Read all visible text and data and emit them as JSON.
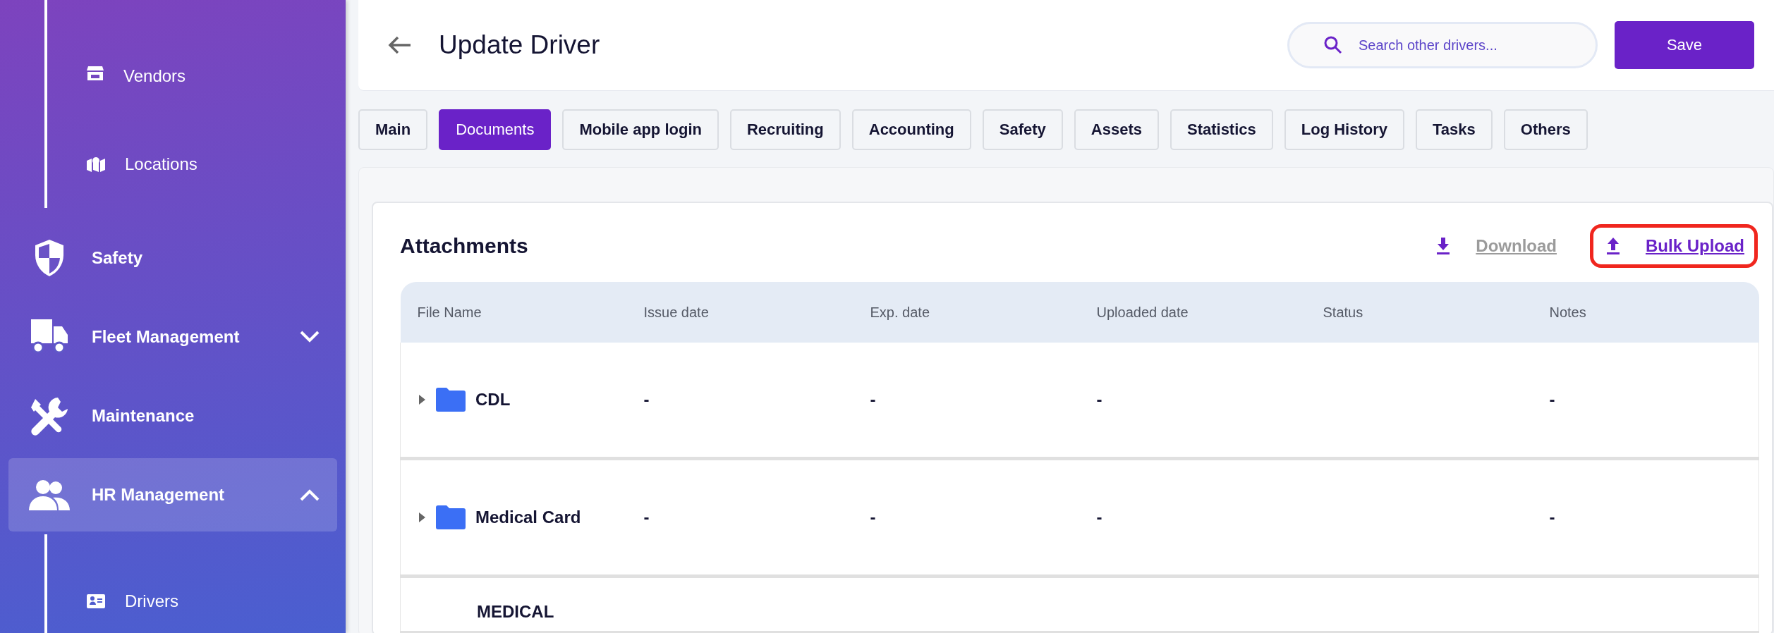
{
  "sidebar": {
    "items": [
      {
        "kind": "subitem",
        "label": "Vendors",
        "selected": false
      },
      {
        "kind": "subitem",
        "label": "Locations",
        "selected": false
      },
      {
        "kind": "item",
        "label": "Safety",
        "selected": false
      },
      {
        "kind": "group",
        "label": "Fleet Management",
        "selected": false,
        "expanded": false
      },
      {
        "kind": "item",
        "label": "Maintenance",
        "selected": false
      },
      {
        "kind": "group",
        "label": "HR Management",
        "selected": true,
        "expanded": true
      },
      {
        "kind": "subitem",
        "label": "Drivers",
        "selected": false
      }
    ]
  },
  "header": {
    "title": "Update Driver",
    "search": {
      "placeholder": "Search other drivers..."
    },
    "save_button": "Save"
  },
  "tabs": [
    {
      "label": "Main",
      "selected": false
    },
    {
      "label": "Documents",
      "selected": true
    },
    {
      "label": "Mobile app login",
      "selected": false
    },
    {
      "label": "Recruiting",
      "selected": false
    },
    {
      "label": "Accounting",
      "selected": false
    },
    {
      "label": "Safety",
      "selected": false
    },
    {
      "label": "Assets",
      "selected": false
    },
    {
      "label": "Statistics",
      "selected": false
    },
    {
      "label": "Log History",
      "selected": false
    },
    {
      "label": "Tasks",
      "selected": false
    },
    {
      "label": "Others",
      "selected": false
    }
  ],
  "attachments": {
    "title": "Attachments",
    "actions": [
      {
        "kind": "download",
        "label": "Download",
        "disabled": true,
        "highlighted": false
      },
      {
        "kind": "upload",
        "label": "Bulk Upload",
        "disabled": false,
        "highlighted": true
      }
    ],
    "columns": [
      "File Name",
      "Issue date",
      "Exp. date",
      "Uploaded date",
      "Status",
      "Notes"
    ],
    "rows": [
      {
        "expanded": false,
        "cells": [
          "CDL",
          "-",
          "-",
          "-",
          "",
          "-"
        ]
      },
      {
        "expanded": false,
        "cells": [
          "Medical Card",
          "-",
          "-",
          "-",
          "",
          "-"
        ]
      },
      {
        "cells": [
          "MEDICAL",
          "",
          "",
          "",
          "",
          ""
        ]
      }
    ]
  }
}
